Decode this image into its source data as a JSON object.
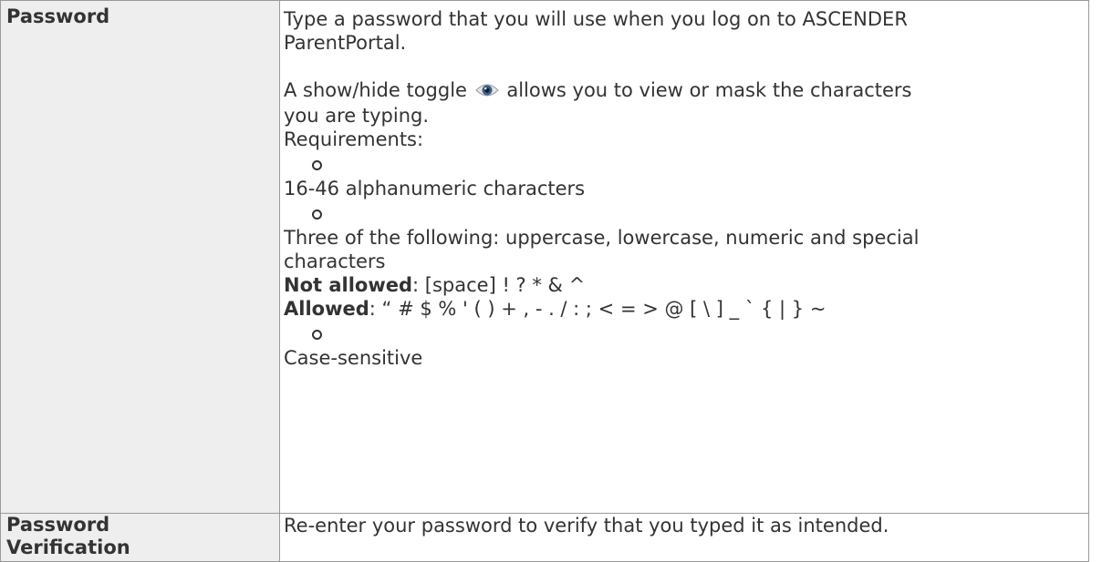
{
  "rows": {
    "password": {
      "label": "Password",
      "intro_line1": "Type a password that you will use when you log on to ASCENDER",
      "intro_line2": "ParentPortal.",
      "toggle_before": "A show/hide toggle",
      "toggle_after": "allows you to view or mask the characters",
      "toggle_line2": "you are typing.",
      "requirements_label": "Requirements:",
      "req1": "16-46 alphanumeric characters",
      "req2_line1": "Three of the following: uppercase, lowercase, numeric and special",
      "req2_line2": "characters",
      "not_allowed_label": "Not allowed",
      "not_allowed_chars": ": [space] ! ? * & ^",
      "allowed_label": "Allowed",
      "allowed_chars": ": “ # $ % ' ( ) + , - . / : ; < = > @ [ \\ ] _ ` { | } ~",
      "req3": "Case-sensitive"
    },
    "verification": {
      "label_line1": "Password",
      "label_line2": "Verification",
      "description": "Re-enter your password to verify that you typed it as intended."
    }
  },
  "icons": {
    "toggle_icon": "eye-icon"
  }
}
